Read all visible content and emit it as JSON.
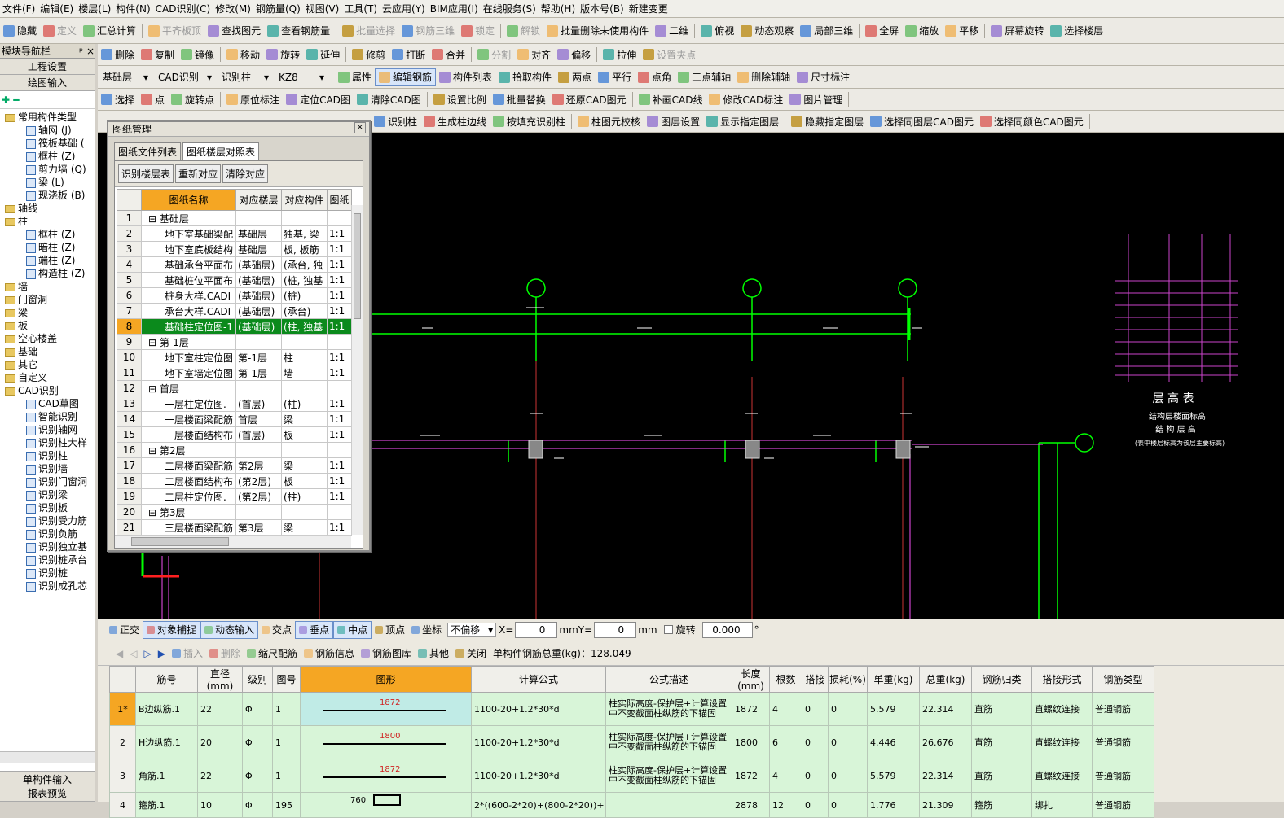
{
  "menu": [
    "文件(F)",
    "编辑(E)",
    "楼层(L)",
    "构件(N)",
    "CAD识别(C)",
    "修改(M)",
    "钢筋量(Q)",
    "视图(V)",
    "工具(T)",
    "云应用(Y)",
    "BIM应用(I)",
    "在线服务(S)",
    "帮助(H)",
    "版本号(B)",
    "新建变更"
  ],
  "toolbar1": [
    "隐藏",
    "定义",
    "汇总计算",
    "平齐板顶",
    "查找图元",
    "查看钢筋量",
    "批量选择",
    "钢筋三维",
    "锁定",
    "解锁",
    "批量删除未使用构件",
    "二维",
    "俯视",
    "动态观察",
    "局部三维",
    "全屏",
    "缩放",
    "平移",
    "屏幕旋转",
    "选择楼层"
  ],
  "toolbar2": [
    "删除",
    "复制",
    "镜像",
    "移动",
    "旋转",
    "延伸",
    "修剪",
    "打断",
    "合并",
    "分割",
    "对齐",
    "偏移",
    "拉伸",
    "设置夹点"
  ],
  "toolbar3": {
    "combos": [
      "基础层",
      "CAD识别",
      "识别柱",
      "KZ8"
    ],
    "items": [
      "属性",
      "编辑钢筋",
      "构件列表",
      "拾取构件",
      "两点",
      "平行",
      "点角",
      "三点辅轴",
      "删除辅轴",
      "尺寸标注"
    ]
  },
  "toolbar4": [
    "选择",
    "点",
    "旋转点",
    "原位标注",
    "定位CAD图",
    "清除CAD图",
    "设置比例",
    "批量替换",
    "还原CAD图元",
    "补画CAD线",
    "修改CAD标注",
    "图片管理"
  ],
  "toolbar5": [
    "识别柱",
    "生成柱边线",
    "按填充识别柱",
    "柱图元校核",
    "图层设置",
    "显示指定图层",
    "隐藏指定图层",
    "选择同图层CAD图元",
    "选择同颜色CAD图元"
  ],
  "left": {
    "title": "模块导航栏",
    "btn1": "工程设置",
    "btn2": "绘图输入",
    "bottom1": "单构件输入",
    "bottom2": "报表预览",
    "tree": [
      "常用构件类型",
      "轴网 (J)",
      "筏板基础 (",
      "框柱 (Z)",
      "剪力墙 (Q)",
      "梁 (L)",
      "现浇板 (B)",
      "轴线",
      "柱",
      "框柱 (Z)",
      "暗柱 (Z)",
      "端柱 (Z)",
      "构造柱 (Z)",
      "墙",
      "门窗洞",
      "梁",
      "板",
      "空心楼盖",
      "基础",
      "其它",
      "自定义",
      "CAD识别",
      "CAD草图",
      "智能识别",
      "识别轴网",
      "识别柱大样",
      "识别柱",
      "识别墙",
      "识别门窗洞",
      "识别梁",
      "识别板",
      "识别受力筋",
      "识别负筋",
      "识别独立基",
      "识别桩承台",
      "识别桩",
      "识别成孔芯"
    ]
  },
  "dialog": {
    "title": "图纸管理",
    "tabs": [
      "图纸文件列表",
      "图纸楼层对照表"
    ],
    "buttons": [
      "识别楼层表",
      "重新对应",
      "清除对应"
    ],
    "headers": [
      "图纸名称",
      "对应楼层",
      "对应构件",
      "图纸"
    ],
    "rows": [
      [
        "1",
        "基础层",
        "",
        "",
        ""
      ],
      [
        "2",
        "地下室基础梁配",
        "基础层",
        "独基, 梁",
        "1:1"
      ],
      [
        "3",
        "地下室底板结构",
        "基础层",
        "板, 板筋",
        "1:1"
      ],
      [
        "4",
        "基础承台平面布",
        "(基础层)",
        "(承台, 独",
        "1:1"
      ],
      [
        "5",
        "基础桩位平面布",
        "(基础层)",
        "(桩, 独基",
        "1:1"
      ],
      [
        "6",
        "桩身大样.CADI",
        "(基础层)",
        "(桩)",
        "1:1"
      ],
      [
        "7",
        "承台大样.CADI",
        "(基础层)",
        "(承台)",
        "1:1"
      ],
      [
        "8",
        "基础柱定位图-1",
        "(基础层)",
        "(柱, 独基",
        "1:1"
      ],
      [
        "9",
        "第-1层",
        "",
        "",
        ""
      ],
      [
        "10",
        "地下室柱定位图",
        "第-1层",
        "柱",
        "1:1"
      ],
      [
        "11",
        "地下室墙定位图",
        "第-1层",
        "墙",
        "1:1"
      ],
      [
        "12",
        "首层",
        "",
        "",
        ""
      ],
      [
        "13",
        "一层柱定位图.",
        "(首层)",
        "(柱)",
        "1:1"
      ],
      [
        "14",
        "一层楼面梁配筋",
        "首层",
        "梁",
        "1:1"
      ],
      [
        "15",
        "一层楼面结构布",
        "(首层)",
        "板",
        "1:1"
      ],
      [
        "16",
        "第2层",
        "",
        "",
        ""
      ],
      [
        "17",
        "二层楼面梁配筋",
        "第2层",
        "梁",
        "1:1"
      ],
      [
        "18",
        "二层楼面结构布",
        "(第2层)",
        "板",
        "1:1"
      ],
      [
        "19",
        "二层柱定位图.",
        "(第2层)",
        "(柱)",
        "1:1"
      ],
      [
        "20",
        "第3层",
        "",
        "",
        ""
      ],
      [
        "21",
        "三层楼面梁配筋",
        "第3层",
        "梁",
        "1:1"
      ]
    ]
  },
  "legend": {
    "title": "层 高 表",
    "l1": "结构层楼面标高",
    "l2": "结 构 层 高",
    "l3": "(表中楼层标高为该层主要标高)"
  },
  "statusbar": {
    "items": [
      "正交",
      "对象捕捉",
      "动态输入",
      "交点",
      "垂点",
      "中点",
      "顶点",
      "坐标"
    ],
    "offset": "不偏移",
    "x": "0",
    "y": "0",
    "rotate": "旋转",
    "angle": "0.000",
    "unit": "mm",
    "deg": "°"
  },
  "rebar": {
    "toolbar": [
      "插入",
      "删除",
      "缩尺配筋",
      "钢筋信息",
      "钢筋图库",
      "其他",
      "关闭"
    ],
    "total": "单构件钢筋总重(kg)：128.049",
    "headers": [
      "筋号",
      "直径(mm)",
      "级别",
      "图号",
      "图形",
      "计算公式",
      "公式描述",
      "长度(mm)",
      "根数",
      "搭接",
      "损耗(%)",
      "单重(kg)",
      "总重(kg)",
      "钢筋归类",
      "搭接形式",
      "钢筋类型"
    ],
    "rows": [
      {
        "no": "1*",
        "name": "B边纵筋.1",
        "d": "22",
        "lv": "Φ",
        "fig": "1",
        "len": "1872",
        "formula": "1100-20+1.2*30*d",
        "desc": "柱实际高度-保护层+计算设置中不变截面柱纵筋的下锚固",
        "length": "1872",
        "count": "4",
        "lap": "0",
        "loss": "0",
        "unit": "5.579",
        "total": "22.314",
        "cls": "直筋",
        "lapform": "直螺纹连接",
        "type": "普通钢筋"
      },
      {
        "no": "2",
        "name": "H边纵筋.1",
        "d": "20",
        "lv": "Φ",
        "fig": "1",
        "len": "1800",
        "formula": "1100-20+1.2*30*d",
        "desc": "柱实际高度-保护层+计算设置中不变截面柱纵筋的下锚固",
        "length": "1800",
        "count": "6",
        "lap": "0",
        "loss": "0",
        "unit": "4.446",
        "total": "26.676",
        "cls": "直筋",
        "lapform": "直螺纹连接",
        "type": "普通钢筋"
      },
      {
        "no": "3",
        "name": "角筋.1",
        "d": "22",
        "lv": "Φ",
        "fig": "1",
        "len": "1872",
        "formula": "1100-20+1.2*30*d",
        "desc": "柱实际高度-保护层+计算设置中不变截面柱纵筋的下锚固",
        "length": "1872",
        "count": "4",
        "lap": "0",
        "loss": "0",
        "unit": "5.579",
        "total": "22.314",
        "cls": "直筋",
        "lapform": "直螺纹连接",
        "type": "普通钢筋"
      },
      {
        "no": "4",
        "name": "箍筋.1",
        "d": "10",
        "lv": "Φ",
        "fig": "195",
        "len": "760",
        "formula": "2*((600-2*20)+(800-2*20))+",
        "desc": "",
        "length": "2878",
        "count": "12",
        "lap": "0",
        "loss": "0",
        "unit": "1.776",
        "total": "21.309",
        "cls": "箍筋",
        "lapform": "绑扎",
        "type": "普通钢筋"
      }
    ]
  }
}
